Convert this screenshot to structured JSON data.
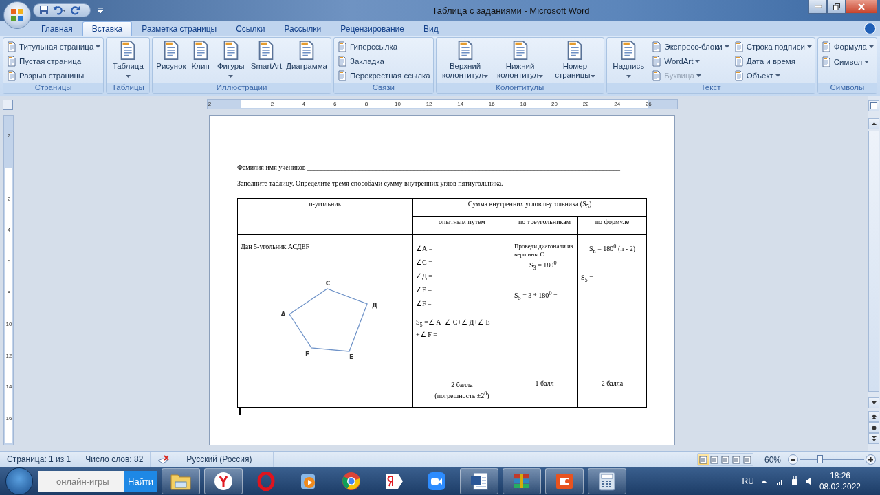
{
  "window": {
    "title": "Таблица с заданиями - Microsoft Word"
  },
  "tabs": [
    {
      "label": "Главная",
      "selected": false
    },
    {
      "label": "Вставка",
      "selected": true
    },
    {
      "label": "Разметка страницы",
      "selected": false
    },
    {
      "label": "Ссылки",
      "selected": false
    },
    {
      "label": "Рассылки",
      "selected": false
    },
    {
      "label": "Рецензирование",
      "selected": false
    },
    {
      "label": "Вид",
      "selected": false
    }
  ],
  "ribbon": [
    {
      "label": "Страницы",
      "columns": [
        {
          "kind": "small",
          "items": [
            {
              "label": "Титульная страница",
              "dropdown": true,
              "disabled": false
            },
            {
              "label": "Пустая страница",
              "dropdown": false,
              "disabled": false
            },
            {
              "label": "Разрыв страницы",
              "dropdown": false,
              "disabled": false
            }
          ]
        }
      ]
    },
    {
      "label": "Таблицы",
      "columns": [
        {
          "kind": "large",
          "items": [
            {
              "label": "Таблица",
              "dropdown": true,
              "disabled": false
            }
          ]
        }
      ]
    },
    {
      "label": "Иллюстрации",
      "columns": [
        {
          "kind": "large",
          "items": [
            {
              "label": "Рисунок",
              "dropdown": false,
              "disabled": false
            },
            {
              "label": "Клип",
              "dropdown": false,
              "disabled": false
            },
            {
              "label": "Фигуры",
              "dropdown": true,
              "disabled": false
            },
            {
              "label": "SmartArt",
              "dropdown": false,
              "disabled": false
            },
            {
              "label": "Диаграмма",
              "dropdown": false,
              "disabled": false
            }
          ]
        }
      ]
    },
    {
      "label": "Связи",
      "columns": [
        {
          "kind": "small",
          "items": [
            {
              "label": "Гиперссылка",
              "dropdown": false,
              "disabled": false
            },
            {
              "label": "Закладка",
              "dropdown": false,
              "disabled": false
            },
            {
              "label": "Перекрестная ссылка",
              "dropdown": false,
              "disabled": false
            }
          ]
        }
      ]
    },
    {
      "label": "Колонтитулы",
      "columns": [
        {
          "kind": "large",
          "items": [
            {
              "label": "Верхний колонтитул",
              "dropdown": true,
              "disabled": false
            },
            {
              "label": "Нижний колонтитул",
              "dropdown": true,
              "disabled": false
            },
            {
              "label": "Номер страницы",
              "dropdown": true,
              "disabled": false
            }
          ]
        }
      ]
    },
    {
      "label": "Текст",
      "columns": [
        {
          "kind": "large",
          "items": [
            {
              "label": "Надпись",
              "dropdown": true,
              "disabled": false
            }
          ]
        },
        {
          "kind": "small",
          "items": [
            {
              "label": "Экспресс-блоки",
              "dropdown": true,
              "disabled": false
            },
            {
              "label": "WordArt",
              "dropdown": true,
              "disabled": false
            },
            {
              "label": "Буквица",
              "dropdown": true,
              "disabled": true
            }
          ]
        },
        {
          "kind": "small",
          "items": [
            {
              "label": "Строка подписи",
              "dropdown": true,
              "disabled": false
            },
            {
              "label": "Дата и время",
              "dropdown": false,
              "disabled": false
            },
            {
              "label": "Объект",
              "dropdown": true,
              "disabled": false
            }
          ]
        }
      ]
    },
    {
      "label": "Символы",
      "columns": [
        {
          "kind": "small",
          "items": [
            {
              "label": "Формула",
              "dropdown": true,
              "disabled": false
            },
            {
              "label": "Символ",
              "dropdown": true,
              "disabled": false
            }
          ]
        }
      ]
    }
  ],
  "ruler": {
    "horizontal": [
      "2",
      "2",
      "4",
      "6",
      "8",
      "10",
      "12",
      "14",
      "16",
      "18",
      "20",
      "22",
      "24",
      "26"
    ],
    "vertical": [
      "2",
      "2",
      "4",
      "6",
      "8",
      "10",
      "12",
      "14",
      "16"
    ]
  },
  "document": {
    "name_line": "Фамилия имя учеников ___________________________________________________________________________________________",
    "instruction": "Заполните таблицу. Определите тремя способами сумму внутренних углов пятиугольника.",
    "table": {
      "polygon_header": "n-угольник",
      "sum_header": "Сумма внутренних углов n-угольника (S$_{5}$)",
      "subheaders": [
        "опытным путем",
        "по треугольникам",
        "по формуле"
      ],
      "given": "Дан 5-угольник АСДЕF",
      "vertices": [
        "A",
        "C",
        "Д",
        "E",
        "F"
      ],
      "experiment": {
        "angles": [
          "∠А =",
          "∠С =",
          "∠Д =",
          "∠Е =",
          "∠F ="
        ],
        "sum": [
          "S$_{5}$ =∠ А+∠ С+∠ Д+∠ Е+",
          "+∠ F ="
        ],
        "score": [
          "2 балла",
          "(погрешность ±2$^{0}$)"
        ]
      },
      "triangles": {
        "note": "Проведи диагонали из вершины С",
        "triangle": "S$_{3}$ = 180$^{0}$",
        "sum": "S$_{5}$ = 3 * 180$^{0}$ =",
        "score": "1 балл"
      },
      "formula": {
        "formula": "S$_{n}$ = 180$^{0}$ (n - 2)",
        "sum": "S$_{5}$ =",
        "score": "2 балла"
      }
    }
  },
  "status_bar": {
    "page": "Страница: 1 из 1",
    "words": "Число слов: 82",
    "language": "Русский (Россия)",
    "views": [
      {
        "selected": true
      },
      {
        "selected": false
      },
      {
        "selected": false
      },
      {
        "selected": false
      },
      {
        "selected": false
      }
    ],
    "zoom": "60%",
    "zoom_slider": {
      "level": 0.32
    }
  },
  "taskbar": {
    "search": {
      "placeholder": "онлайн-игры",
      "button": "Найти"
    },
    "apps": [
      {
        "active": true
      },
      {
        "active": true
      },
      {
        "active": false
      },
      {
        "active": false
      },
      {
        "active": false
      },
      {
        "active": false
      },
      {
        "active": false
      },
      {
        "active": true
      },
      {
        "active": true
      },
      {
        "active": true
      },
      {
        "active": true
      }
    ],
    "tray": {
      "language": "RU",
      "time": "18:26",
      "date": "08.02.2022"
    }
  }
}
